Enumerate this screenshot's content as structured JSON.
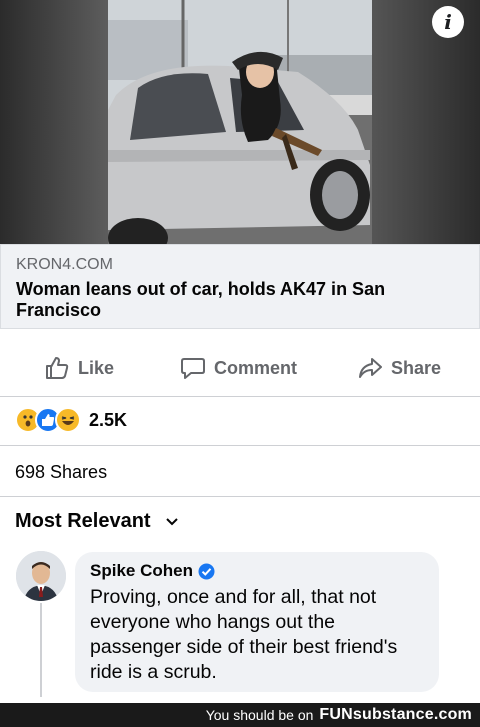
{
  "post": {
    "link": {
      "domain": "KRON4.COM",
      "title": "Woman leans out of car, holds AK47 in San Francisco"
    },
    "media_info_icon": "i"
  },
  "actions": {
    "like_label": "Like",
    "comment_label": "Comment",
    "share_label": "Share"
  },
  "reactions": {
    "icons": [
      "wow-reaction-icon",
      "like-reaction-icon",
      "haha-reaction-icon"
    ],
    "count": "2.5K"
  },
  "shares": {
    "text": "698 Shares"
  },
  "comments": {
    "sort_label": "Most Relevant",
    "items": [
      {
        "author": "Spike Cohen",
        "verified": true,
        "text": "Proving, once and for all, that not everyone who hangs out the passenger side of their best friend's ride is a scrub."
      }
    ]
  },
  "footer": {
    "prefix": "You should be on",
    "brand": "FUNsubstance.com"
  },
  "colors": {
    "accent_blue": "#1877f2",
    "secondary_text": "#65676b",
    "divider": "#ced0d4",
    "bubble_bg": "#f0f2f5"
  }
}
